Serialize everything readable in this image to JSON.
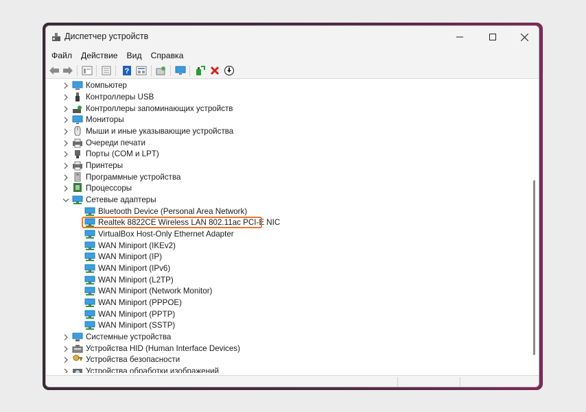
{
  "window": {
    "title": "Диспетчер устройств",
    "controls": {
      "minimize": "—",
      "maximize": "☐",
      "close": "✕"
    }
  },
  "menu": [
    {
      "label": "Файл"
    },
    {
      "label": "Действие"
    },
    {
      "label": "Вид"
    },
    {
      "label": "Справка"
    }
  ],
  "toolbar": {
    "icons": [
      "back-icon",
      "forward-icon",
      "properties-view-icon",
      "list-view-icon",
      "help-icon",
      "details-view-icon",
      "scan-hardware-icon",
      "monitor-icon",
      "update-driver-icon",
      "uninstall-icon",
      "disable-icon"
    ]
  },
  "colors": {
    "highlight": "#f0752a",
    "uninstall": "#d9201c",
    "network_icon": "#2e9bd6"
  },
  "tree": {
    "top_categories": [
      {
        "label": "Компьютер",
        "icon": "computer-icon"
      },
      {
        "label": "Контроллеры USB",
        "icon": "usb-icon"
      },
      {
        "label": "Контроллеры запоминающих устройств",
        "icon": "storage-controller-icon"
      },
      {
        "label": "Мониторы",
        "icon": "monitor-icon"
      },
      {
        "label": "Мыши и иные указывающие устройства",
        "icon": "mouse-icon"
      },
      {
        "label": "Очереди печати",
        "icon": "print-queue-icon"
      },
      {
        "label": "Порты (COM и LPT)",
        "icon": "port-icon"
      },
      {
        "label": "Принтеры",
        "icon": "printer-icon"
      },
      {
        "label": "Программные устройства",
        "icon": "software-device-icon"
      },
      {
        "label": "Процессоры",
        "icon": "processor-icon"
      }
    ],
    "expanded_category": {
      "label": "Сетевые адаптеры",
      "icon": "network-adapter-icon"
    },
    "network_adapters": [
      {
        "label": "Bluetooth Device (Personal Area Network)"
      },
      {
        "label": "Realtek 8822CE Wireless LAN 802.11ac PCI-E NIC",
        "highlighted": true
      },
      {
        "label": "VirtualBox Host-Only Ethernet Adapter"
      },
      {
        "label": "WAN Miniport (IKEv2)"
      },
      {
        "label": "WAN Miniport (IP)"
      },
      {
        "label": "WAN Miniport (IPv6)"
      },
      {
        "label": "WAN Miniport (L2TP)"
      },
      {
        "label": "WAN Miniport (Network Monitor)"
      },
      {
        "label": "WAN Miniport (PPPOE)"
      },
      {
        "label": "WAN Miniport (PPTP)"
      },
      {
        "label": "WAN Miniport (SSTP)"
      }
    ],
    "bottom_categories": [
      {
        "label": "Системные устройства",
        "icon": "system-devices-icon"
      },
      {
        "label": "Устройства HID (Human Interface Devices)",
        "icon": "hid-icon"
      },
      {
        "label": "Устройства безопасности",
        "icon": "security-device-icon"
      },
      {
        "label": "Устройства обработки изображений",
        "icon": "imaging-device-icon"
      }
    ]
  }
}
